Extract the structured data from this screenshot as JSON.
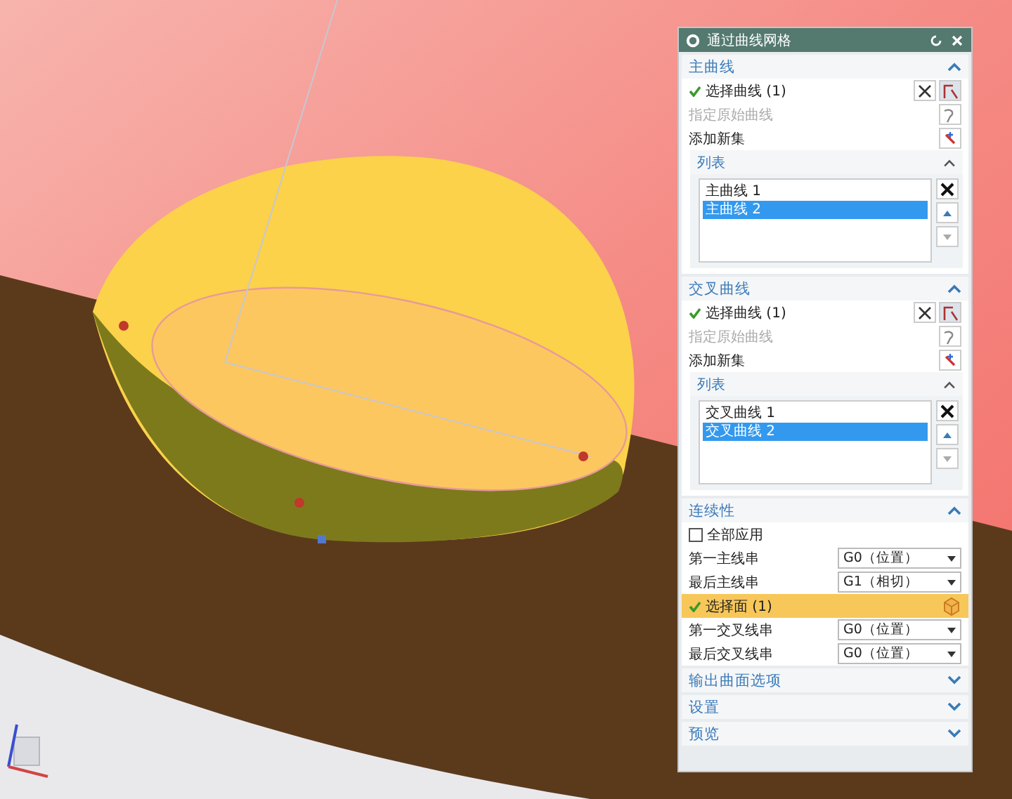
{
  "dialog": {
    "title": "通过曲线网格"
  },
  "sections": [
    {
      "kind": "curves",
      "title": "主曲线",
      "expanded": true,
      "select": {
        "label": "选择曲线 (1)",
        "done": true
      },
      "origin_label": "指定原始曲线",
      "add_label": "添加新集",
      "list": {
        "title": "列表",
        "expanded": true,
        "items": [
          {
            "label": "主曲线 1",
            "selected": false
          },
          {
            "label": "主曲线 2",
            "selected": true
          }
        ]
      }
    },
    {
      "kind": "curves",
      "title": "交叉曲线",
      "expanded": true,
      "select": {
        "label": "选择曲线 (1)",
        "done": true
      },
      "origin_label": "指定原始曲线",
      "add_label": "添加新集",
      "list": {
        "title": "列表",
        "expanded": true,
        "items": [
          {
            "label": "交叉曲线 1",
            "selected": false
          },
          {
            "label": "交叉曲线 2",
            "selected": true
          }
        ]
      }
    },
    {
      "kind": "continuity",
      "title": "连续性",
      "expanded": true,
      "apply_all": {
        "label": "全部应用",
        "checked": false
      },
      "rows": [
        {
          "kind": "dropdown",
          "label": "第一主线串",
          "value": "G0（位置）"
        },
        {
          "kind": "dropdown",
          "label": "最后主线串",
          "value": "G1（相切）"
        },
        {
          "kind": "face",
          "label": "选择面 (1)",
          "done": true
        },
        {
          "kind": "dropdown",
          "label": "第一交叉线串",
          "value": "G0（位置）"
        },
        {
          "kind": "dropdown",
          "label": "最后交叉线串",
          "value": "G0（位置）"
        }
      ]
    },
    {
      "kind": "group",
      "title": "输出曲面选项",
      "expanded": false
    },
    {
      "kind": "group",
      "title": "设置",
      "expanded": false
    },
    {
      "kind": "group",
      "title": "预览",
      "expanded": false
    }
  ]
}
